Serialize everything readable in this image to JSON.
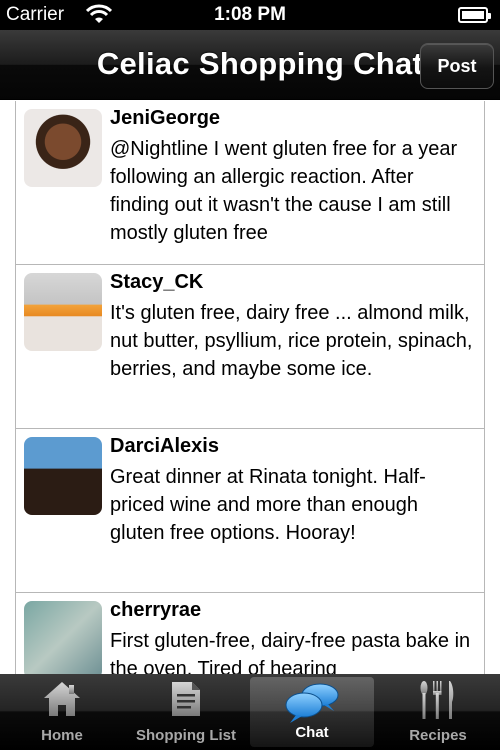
{
  "status_bar": {
    "carrier": "Carrier",
    "time": "1:08 PM",
    "wifi_icon": "wifi-icon",
    "battery_icon": "battery-full-icon"
  },
  "nav_bar": {
    "title": "Celiac Shopping Chat",
    "post_label": "Post"
  },
  "posts": [
    {
      "author": "JeniGeorge",
      "message": "@Nightline I went gluten free for a year following an allergic reaction. After finding out it wasn't the cause I am still mostly gluten free"
    },
    {
      "author": "Stacy_CK",
      "message": "It's gluten free, dairy free ... almond milk, nut butter, psyllium, rice protein, spinach, berries, and maybe some ice."
    },
    {
      "author": "DarciAlexis",
      "message": "Great dinner at Rinata tonight. Half-priced wine and more than enough gluten free options. Hooray!"
    },
    {
      "author": "cherryrae",
      "message": "First gluten-free, dairy-free pasta bake in the oven. Tired of hearing"
    }
  ],
  "tab_bar": {
    "tabs": [
      {
        "label": "Home",
        "icon": "home-icon",
        "selected": false
      },
      {
        "label": "Shopping List",
        "icon": "document-icon",
        "selected": false
      },
      {
        "label": "Chat",
        "icon": "chat-bubbles-icon",
        "selected": true
      },
      {
        "label": "Recipes",
        "icon": "utensils-icon",
        "selected": false
      }
    ]
  }
}
